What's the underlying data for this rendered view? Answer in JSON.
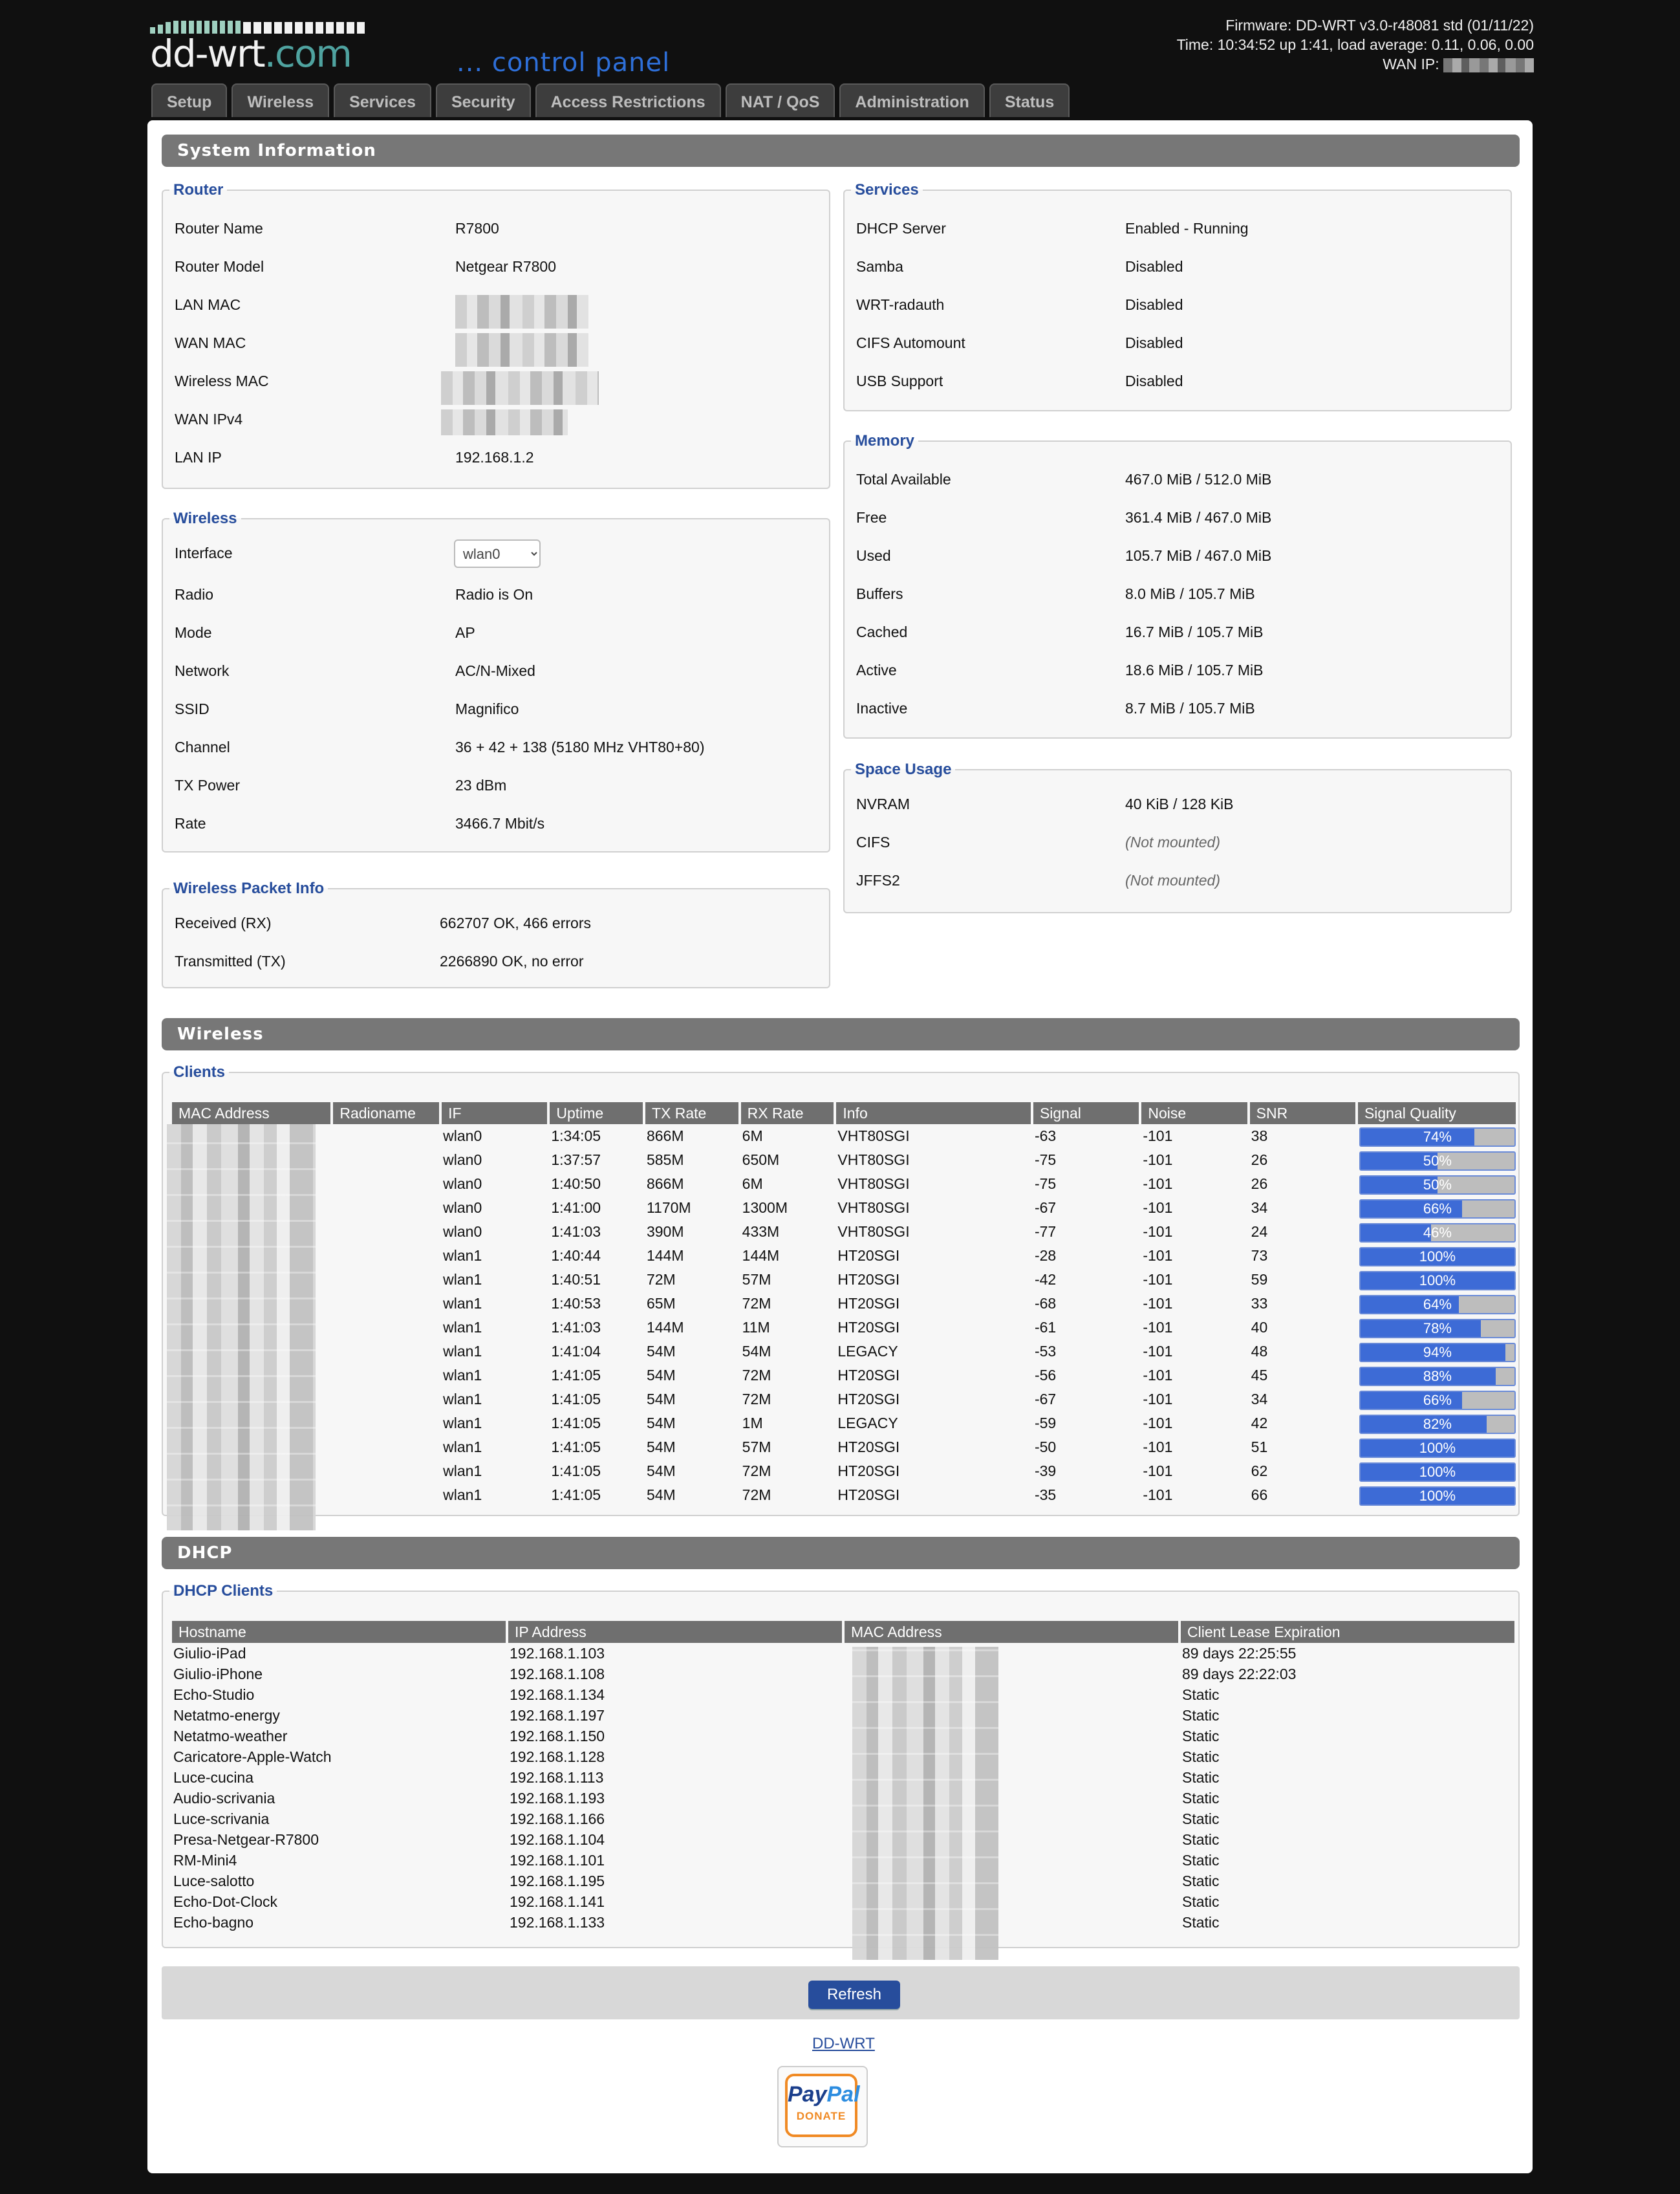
{
  "header": {
    "logo_text": "dd-wrt",
    "logo_suffix": ".com",
    "control_panel": "... control panel",
    "firmware": "Firmware: DD-WRT v3.0-r48081 std (01/11/22)",
    "time": "Time: 10:34:52 up 1:41, load average: 0.11, 0.06, 0.00",
    "wan_ip_label": "WAN IP:"
  },
  "tabs": [
    "Setup",
    "Wireless",
    "Services",
    "Security",
    "Access Restrictions",
    "NAT / QoS",
    "Administration",
    "Status"
  ],
  "system_info": {
    "title": "System Information",
    "router": {
      "legend": "Router",
      "rows": [
        {
          "k": "Router Name",
          "v": "R7800"
        },
        {
          "k": "Router Model",
          "v": "Netgear R7800"
        },
        {
          "k": "LAN MAC",
          "v": ""
        },
        {
          "k": "WAN MAC",
          "v": ""
        },
        {
          "k": "Wireless MAC",
          "v": ""
        },
        {
          "k": "WAN IPv4",
          "v": ""
        },
        {
          "k": "LAN IP",
          "v": "192.168.1.2"
        }
      ]
    },
    "wireless": {
      "legend": "Wireless",
      "interface_label": "Interface",
      "interface_value": "wlan0",
      "rows": [
        {
          "k": "Radio",
          "v": "Radio is On"
        },
        {
          "k": "Mode",
          "v": "AP"
        },
        {
          "k": "Network",
          "v": "AC/N-Mixed"
        },
        {
          "k": "SSID",
          "v": "Magnifico"
        },
        {
          "k": "Channel",
          "v": "36 + 42 + 138 (5180 MHz VHT80+80)"
        },
        {
          "k": "TX Power",
          "v": "23 dBm"
        },
        {
          "k": "Rate",
          "v": "3466.7 Mbit/s"
        }
      ]
    },
    "packet_info": {
      "legend": "Wireless Packet Info",
      "rows": [
        {
          "k": "Received (RX)",
          "v": "662707 OK, 466 errors"
        },
        {
          "k": "Transmitted (TX)",
          "v": "2266890 OK, no error"
        }
      ]
    },
    "services": {
      "legend": "Services",
      "rows": [
        {
          "k": "DHCP Server",
          "v": "Enabled - Running"
        },
        {
          "k": "Samba",
          "v": "Disabled"
        },
        {
          "k": "WRT-radauth",
          "v": "Disabled"
        },
        {
          "k": "CIFS Automount",
          "v": "Disabled"
        },
        {
          "k": "USB Support",
          "v": "Disabled"
        }
      ]
    },
    "memory": {
      "legend": "Memory",
      "rows": [
        {
          "k": "Total Available",
          "v": "467.0 MiB / 512.0 MiB"
        },
        {
          "k": "Free",
          "v": "361.4 MiB / 467.0 MiB"
        },
        {
          "k": "Used",
          "v": "105.7 MiB / 467.0 MiB"
        },
        {
          "k": "Buffers",
          "v": "8.0 MiB / 105.7 MiB"
        },
        {
          "k": "Cached",
          "v": "16.7 MiB / 105.7 MiB"
        },
        {
          "k": "Active",
          "v": "18.6 MiB / 105.7 MiB"
        },
        {
          "k": "Inactive",
          "v": "8.7 MiB / 105.7 MiB"
        }
      ]
    },
    "space": {
      "legend": "Space Usage",
      "rows": [
        {
          "k": "NVRAM",
          "v": "40 KiB / 128 KiB"
        },
        {
          "k": "CIFS",
          "v": "(Not mounted)"
        },
        {
          "k": "JFFS2",
          "v": "(Not mounted)"
        }
      ]
    }
  },
  "wireless_section": {
    "title": "Wireless",
    "legend": "Clients",
    "columns": [
      "MAC Address",
      "Radioname",
      "IF",
      "Uptime",
      "TX Rate",
      "RX Rate",
      "Info",
      "Signal",
      "Noise",
      "SNR",
      "Signal Quality"
    ],
    "rows": [
      {
        "if": "wlan0",
        "uptime": "1:34:05",
        "tx": "866M",
        "rx": "6M",
        "info": "VHT80SGI",
        "signal": "-63",
        "noise": "-101",
        "snr": "38",
        "quality": "74%",
        "q": 74
      },
      {
        "if": "wlan0",
        "uptime": "1:37:57",
        "tx": "585M",
        "rx": "650M",
        "info": "VHT80SGI",
        "signal": "-75",
        "noise": "-101",
        "snr": "26",
        "quality": "50%",
        "q": 50
      },
      {
        "if": "wlan0",
        "uptime": "1:40:50",
        "tx": "866M",
        "rx": "6M",
        "info": "VHT80SGI",
        "signal": "-75",
        "noise": "-101",
        "snr": "26",
        "quality": "50%",
        "q": 50
      },
      {
        "if": "wlan0",
        "uptime": "1:41:00",
        "tx": "1170M",
        "rx": "1300M",
        "info": "VHT80SGI",
        "signal": "-67",
        "noise": "-101",
        "snr": "34",
        "quality": "66%",
        "q": 66
      },
      {
        "if": "wlan0",
        "uptime": "1:41:03",
        "tx": "390M",
        "rx": "433M",
        "info": "VHT80SGI",
        "signal": "-77",
        "noise": "-101",
        "snr": "24",
        "quality": "46%",
        "q": 46
      },
      {
        "if": "wlan1",
        "uptime": "1:40:44",
        "tx": "144M",
        "rx": "144M",
        "info": "HT20SGI",
        "signal": "-28",
        "noise": "-101",
        "snr": "73",
        "quality": "100%",
        "q": 100
      },
      {
        "if": "wlan1",
        "uptime": "1:40:51",
        "tx": "72M",
        "rx": "57M",
        "info": "HT20SGI",
        "signal": "-42",
        "noise": "-101",
        "snr": "59",
        "quality": "100%",
        "q": 100
      },
      {
        "if": "wlan1",
        "uptime": "1:40:53",
        "tx": "65M",
        "rx": "72M",
        "info": "HT20SGI",
        "signal": "-68",
        "noise": "-101",
        "snr": "33",
        "quality": "64%",
        "q": 64
      },
      {
        "if": "wlan1",
        "uptime": "1:41:03",
        "tx": "144M",
        "rx": "11M",
        "info": "HT20SGI",
        "signal": "-61",
        "noise": "-101",
        "snr": "40",
        "quality": "78%",
        "q": 78
      },
      {
        "if": "wlan1",
        "uptime": "1:41:04",
        "tx": "54M",
        "rx": "54M",
        "info": "LEGACY",
        "signal": "-53",
        "noise": "-101",
        "snr": "48",
        "quality": "94%",
        "q": 94
      },
      {
        "if": "wlan1",
        "uptime": "1:41:05",
        "tx": "54M",
        "rx": "72M",
        "info": "HT20SGI",
        "signal": "-56",
        "noise": "-101",
        "snr": "45",
        "quality": "88%",
        "q": 88
      },
      {
        "if": "wlan1",
        "uptime": "1:41:05",
        "tx": "54M",
        "rx": "72M",
        "info": "HT20SGI",
        "signal": "-67",
        "noise": "-101",
        "snr": "34",
        "quality": "66%",
        "q": 66
      },
      {
        "if": "wlan1",
        "uptime": "1:41:05",
        "tx": "54M",
        "rx": "1M",
        "info": "LEGACY",
        "signal": "-59",
        "noise": "-101",
        "snr": "42",
        "quality": "82%",
        "q": 82
      },
      {
        "if": "wlan1",
        "uptime": "1:41:05",
        "tx": "54M",
        "rx": "57M",
        "info": "HT20SGI",
        "signal": "-50",
        "noise": "-101",
        "snr": "51",
        "quality": "100%",
        "q": 100
      },
      {
        "if": "wlan1",
        "uptime": "1:41:05",
        "tx": "54M",
        "rx": "72M",
        "info": "HT20SGI",
        "signal": "-39",
        "noise": "-101",
        "snr": "62",
        "quality": "100%",
        "q": 100
      },
      {
        "if": "wlan1",
        "uptime": "1:41:05",
        "tx": "54M",
        "rx": "72M",
        "info": "HT20SGI",
        "signal": "-35",
        "noise": "-101",
        "snr": "66",
        "quality": "100%",
        "q": 100
      }
    ]
  },
  "dhcp_section": {
    "title": "DHCP",
    "legend": "DHCP Clients",
    "columns": [
      "Hostname",
      "IP Address",
      "MAC Address",
      "Client Lease Expiration"
    ],
    "rows": [
      {
        "host": "Giulio-iPad",
        "ip": "192.168.1.103",
        "lease": "89 days 22:25:55"
      },
      {
        "host": "Giulio-iPhone",
        "ip": "192.168.1.108",
        "lease": "89 days 22:22:03"
      },
      {
        "host": "Echo-Studio",
        "ip": "192.168.1.134",
        "lease": "Static"
      },
      {
        "host": "Netatmo-energy",
        "ip": "192.168.1.197",
        "lease": "Static"
      },
      {
        "host": "Netatmo-weather",
        "ip": "192.168.1.150",
        "lease": "Static"
      },
      {
        "host": "Caricatore-Apple-Watch",
        "ip": "192.168.1.128",
        "lease": "Static"
      },
      {
        "host": "Luce-cucina",
        "ip": "192.168.1.113",
        "lease": "Static"
      },
      {
        "host": "Audio-scrivania",
        "ip": "192.168.1.193",
        "lease": "Static"
      },
      {
        "host": "Luce-scrivania",
        "ip": "192.168.1.166",
        "lease": "Static"
      },
      {
        "host": "Presa-Netgear-R7800",
        "ip": "192.168.1.104",
        "lease": "Static"
      },
      {
        "host": "RM-Mini4",
        "ip": "192.168.1.101",
        "lease": "Static"
      },
      {
        "host": "Luce-salotto",
        "ip": "192.168.1.195",
        "lease": "Static"
      },
      {
        "host": "Echo-Dot-Clock",
        "ip": "192.168.1.141",
        "lease": "Static"
      },
      {
        "host": "Echo-bagno",
        "ip": "192.168.1.133",
        "lease": "Static"
      }
    ]
  },
  "footer": {
    "refresh_label": "Refresh",
    "link_label": "DD-WRT",
    "paypal_a": "Pay",
    "paypal_b": "Pal",
    "paypal_donate": "DONATE"
  },
  "colors": {
    "accent": "#274d9c",
    "section_bar": "#777777",
    "quality_fill": "#3d6bd6"
  }
}
